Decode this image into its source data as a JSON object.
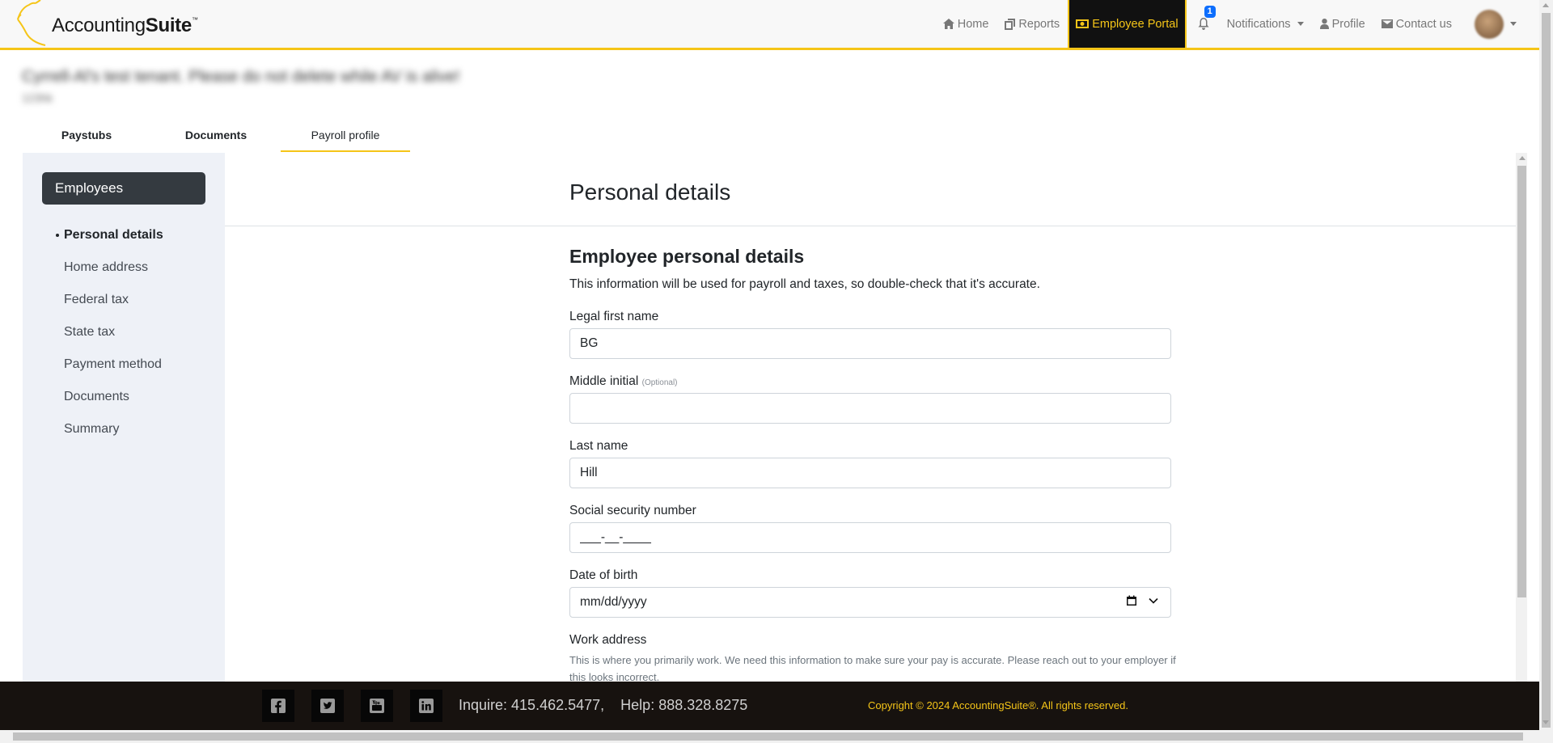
{
  "brand": {
    "name_regular": "Accounting",
    "name_bold": "Suite",
    "trademark": "™",
    "accent_color": "#f5c518",
    "dark_color": "#111111"
  },
  "nav": {
    "home": "Home",
    "reports": "Reports",
    "employee_portal": "Employee Portal",
    "notification_count": "1",
    "notifications": "Notifications",
    "profile": "Profile",
    "contact": "Contact us"
  },
  "tenant": {
    "title": "Cyrrell-Al's test tenant. Please do not delete while AV is alive!",
    "subtitle": "123hk"
  },
  "tabs": {
    "paystubs": "Paystubs",
    "documents": "Documents",
    "payroll_profile": "Payroll profile",
    "active": "Payroll profile"
  },
  "sidebar": {
    "heading": "Employees",
    "items": [
      {
        "label": "Personal details"
      },
      {
        "label": "Home address"
      },
      {
        "label": "Federal tax"
      },
      {
        "label": "State tax"
      },
      {
        "label": "Payment method"
      },
      {
        "label": "Documents"
      },
      {
        "label": "Summary"
      }
    ]
  },
  "main": {
    "title": "Personal details",
    "section_title": "Employee personal details",
    "section_desc": "This information will be used for payroll and taxes, so double-check that it's accurate."
  },
  "form": {
    "first_name": {
      "label": "Legal first name",
      "value": "BG"
    },
    "middle_initial": {
      "label": "Middle initial",
      "optional": "(Optional)",
      "value": ""
    },
    "last_name": {
      "label": "Last name",
      "value": "Hill"
    },
    "ssn": {
      "label": "Social security number",
      "placeholder": "___-__-____"
    },
    "dob": {
      "label": "Date of birth",
      "placeholder": "mm/dd/yyyy"
    },
    "work_address": {
      "label": "Work address",
      "help": "This is where you primarily work. We need this information to make sure your pay is accurate. Please reach out to your employer if this looks incorrect."
    }
  },
  "footer": {
    "social_icons": [
      "facebook-icon",
      "twitter-icon",
      "youtube-icon",
      "linkedin-icon"
    ],
    "inquire": "Inquire: 415.462.5477,",
    "help": "Help: 888.328.8275",
    "copyright": "Copyright © 2024 AccountingSuite®. All rights reserved."
  }
}
